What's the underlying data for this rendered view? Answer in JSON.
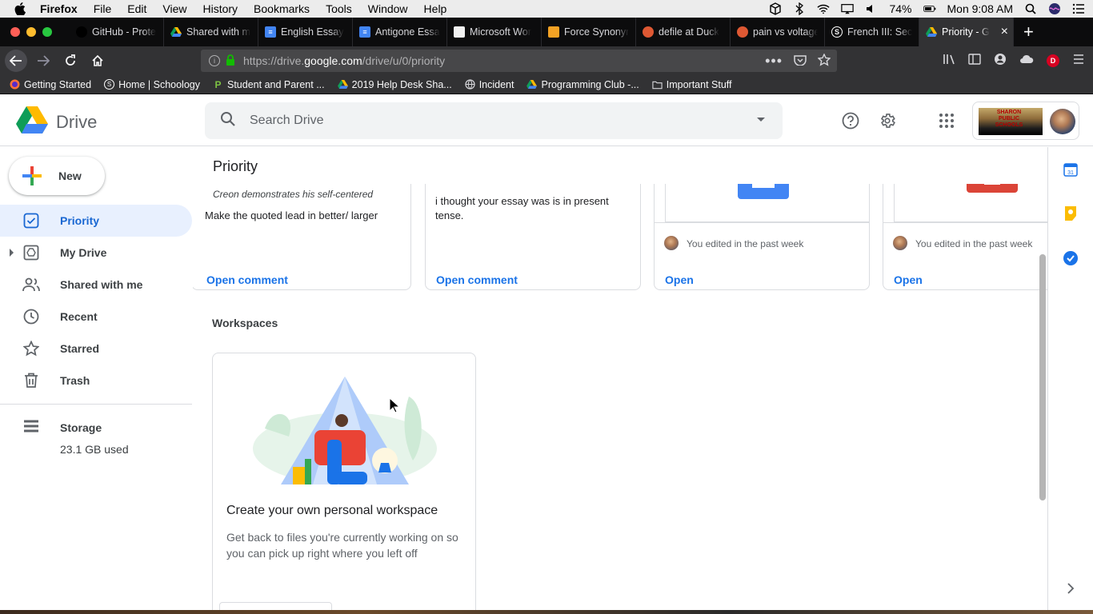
{
  "menubar": {
    "app": "Firefox",
    "items": [
      "File",
      "Edit",
      "View",
      "History",
      "Bookmarks",
      "Tools",
      "Window",
      "Help"
    ],
    "battery": "74%",
    "clock": "Mon 9:08 AM"
  },
  "tabs": [
    {
      "title": "GitHub - Prote",
      "icon": "github-icon"
    },
    {
      "title": "Shared with m",
      "icon": "drive-icon"
    },
    {
      "title": "English Essay",
      "icon": "docs-icon"
    },
    {
      "title": "Antigone Essa",
      "icon": "docs-icon"
    },
    {
      "title": "Microsoft Wor",
      "icon": "page-icon"
    },
    {
      "title": "Force Synonym",
      "icon": "thesaurus-icon"
    },
    {
      "title": "defile at Duck",
      "icon": "duckduckgo-icon"
    },
    {
      "title": "pain vs voltage",
      "icon": "duckduckgo-icon"
    },
    {
      "title": "French III: Sec",
      "icon": "schoology-icon"
    },
    {
      "title": "Priority - G",
      "icon": "drive-icon",
      "active": true
    }
  ],
  "url": {
    "scheme": "https://drive.",
    "host": "google.com",
    "path": "/drive/u/0/priority"
  },
  "bookmarks": [
    {
      "label": "Getting Started",
      "icon": "firefox-icon"
    },
    {
      "label": "Home | Schoology",
      "icon": "schoology-icon"
    },
    {
      "label": "Student and Parent ...",
      "icon": "p-icon"
    },
    {
      "label": "2019 Help Desk Sha...",
      "icon": "drive-icon"
    },
    {
      "label": "Incident",
      "icon": "globe-icon"
    },
    {
      "label": "Programming Club -...",
      "icon": "drive-icon"
    },
    {
      "label": "Important Stuff",
      "icon": "folder-icon"
    }
  ],
  "header": {
    "logo_text": "Drive",
    "search_placeholder": "Search Drive",
    "school_text": "SHARON PUBLIC SCHOOLS"
  },
  "sidebar": {
    "new_label": "New",
    "items": [
      {
        "label": "Priority",
        "icon": "priority-icon",
        "active": true
      },
      {
        "label": "My Drive",
        "icon": "my-drive-icon"
      },
      {
        "label": "Shared with me",
        "icon": "shared-icon"
      },
      {
        "label": "Recent",
        "icon": "clock-icon"
      },
      {
        "label": "Starred",
        "icon": "star-icon"
      },
      {
        "label": "Trash",
        "icon": "trash-icon"
      }
    ],
    "storage_label": "Storage",
    "storage_used": "23.1 GB used"
  },
  "main": {
    "title": "Priority",
    "cards": [
      {
        "quote": "Creon demonstrates his self-centered",
        "text": "Make the quoted lead in better/ larger",
        "action": "Open comment"
      },
      {
        "text": "i thought your essay was is in present tense.",
        "action": "Open comment"
      },
      {
        "edited": "You edited in the past week",
        "action": "Open",
        "color": "#4285f4"
      },
      {
        "edited": "You edited in the past week",
        "action": "Open",
        "color": "#db4437"
      }
    ],
    "workspaces_title": "Workspaces",
    "workspace": {
      "heading": "Create your own personal workspace",
      "description": "Get back to files you're currently working on so you can pick up right where you left off"
    }
  },
  "colors": {
    "accent": "#1a73e8",
    "active_bg": "#e8f0fe",
    "tab_bg": "#0c0c0d",
    "toolbar_bg": "#323234"
  }
}
